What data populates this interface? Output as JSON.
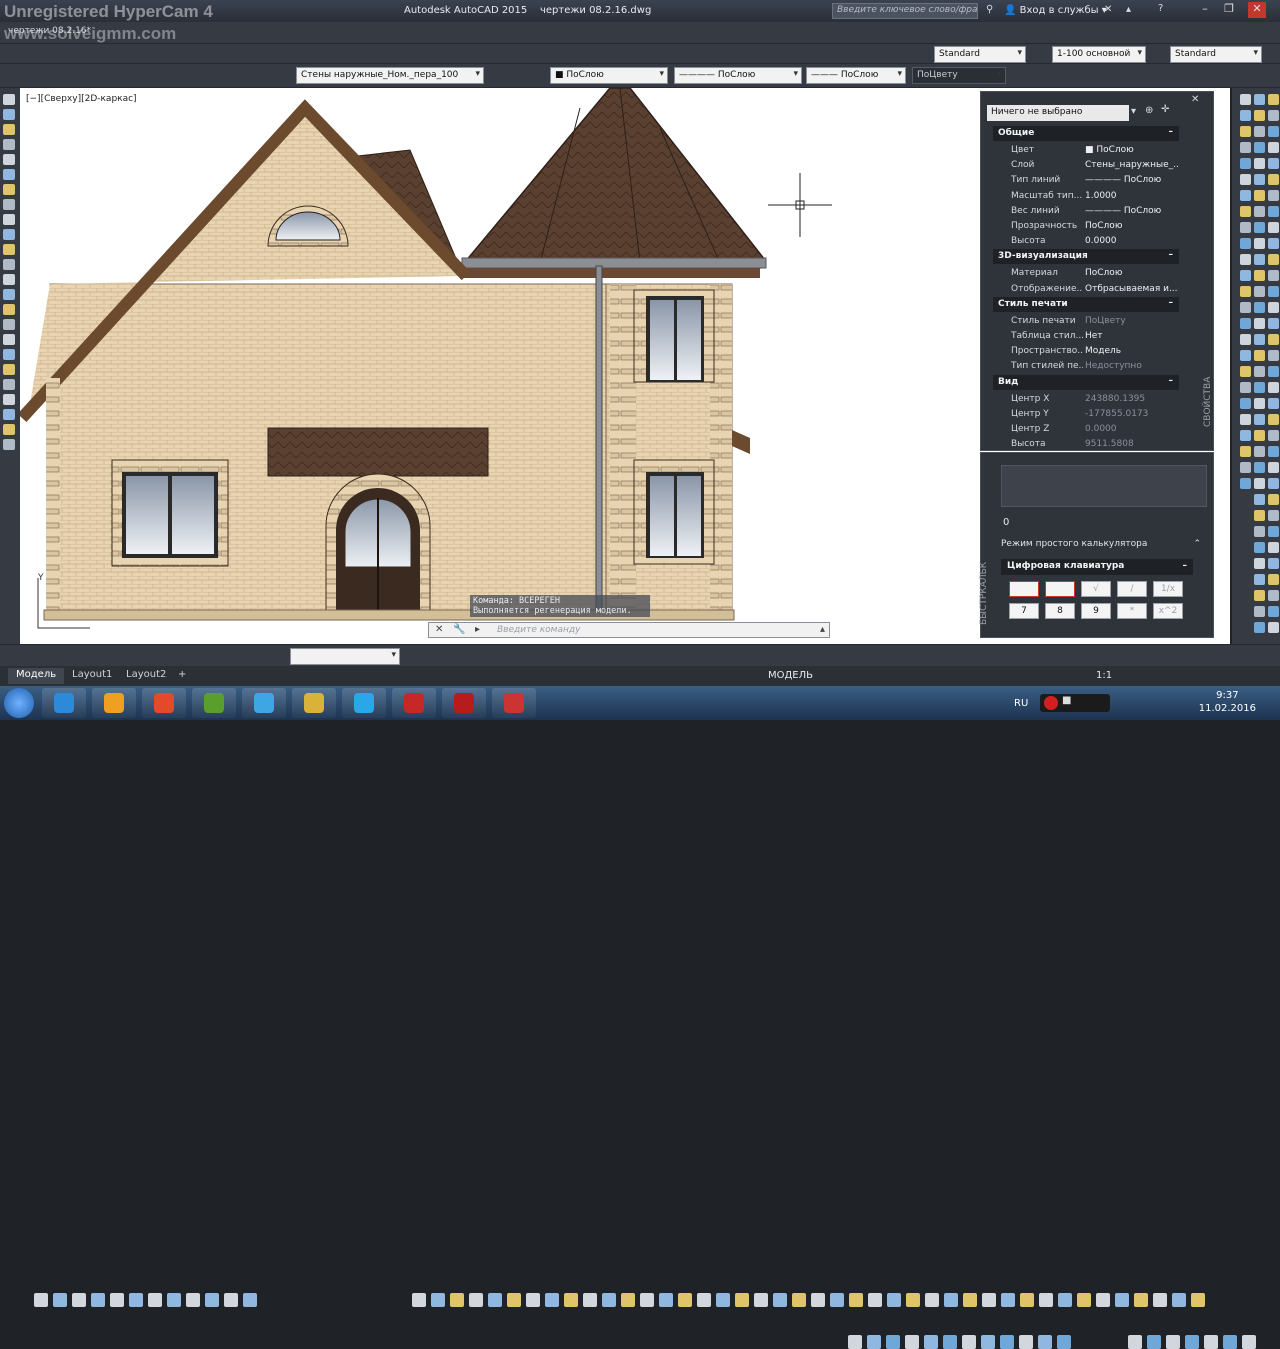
{
  "window": {
    "app_title": "Autodesk AutoCAD 2015",
    "file_title": "чертежи 08.2.16.dwg",
    "search_placeholder": "Введите ключевое слово/фразу",
    "signin": "Вход в службы",
    "watermark_top": "Unregistered HyperCam 4",
    "watermark_sub": "www.solveigmm.com",
    "tab_caption": "чертежи 08.2.16*"
  },
  "toolbar1": {
    "text_style": "Standard",
    "dim_scale": "1-100 основной",
    "table_style": "Standard"
  },
  "toolbar2": {
    "layer": "Стены наружные_Ном._пера_100",
    "color": "ПоСлою",
    "linetype": "ПоСлою",
    "lineweight": "ПоСлою",
    "plotstyle": "ПоЦвету"
  },
  "viewport": {
    "label": "[−][Сверху][2D-каркас]"
  },
  "properties": {
    "selection": "Ничего не выбрано",
    "palette_title": "СВОЙСТВА",
    "sections": [
      {
        "title": "Общие",
        "rows": [
          {
            "k": "Цвет",
            "v": "■ ПоСлою"
          },
          {
            "k": "Слой",
            "v": "Стены_наружные_..."
          },
          {
            "k": "Тип линий",
            "v": "———— ПоСлою"
          },
          {
            "k": "Масштаб тип...",
            "v": "1.0000"
          },
          {
            "k": "Вес линий",
            "v": "———— ПоСлою"
          },
          {
            "k": "Прозрачность",
            "v": "ПоСлою"
          },
          {
            "k": "Высота",
            "v": "0.0000"
          }
        ]
      },
      {
        "title": "3D-визуализация",
        "rows": [
          {
            "k": "Материал",
            "v": "ПоСлою"
          },
          {
            "k": "Отображение...",
            "v": "Отбрасываемая и..."
          }
        ]
      },
      {
        "title": "Стиль печати",
        "rows": [
          {
            "k": "Стиль печати",
            "v": "ПоЦвету"
          },
          {
            "k": "Таблица стил...",
            "v": "Нет"
          },
          {
            "k": "Пространство...",
            "v": "Модель"
          },
          {
            "k": "Тип стилей пе...",
            "v": "Недоступно"
          }
        ]
      },
      {
        "title": "Вид",
        "rows": [
          {
            "k": "Центр X",
            "v": "243880.1395"
          },
          {
            "k": "Центр Y",
            "v": "-177855.0173"
          },
          {
            "k": "Центр Z",
            "v": "0.0000"
          },
          {
            "k": "Высота",
            "v": "9511.5808"
          }
        ]
      }
    ]
  },
  "calculator": {
    "palette_title": "БЫСТРКАЛЬК",
    "value": "0",
    "mode": "Режим простого калькулятора",
    "keypad_title": "Цифровая клавиатура",
    "keys_row1": [
      "",
      "",
      "√",
      "/",
      "1/x"
    ],
    "keys_row2": [
      "7",
      "8",
      "9",
      "*",
      "x^2"
    ]
  },
  "command": {
    "history1": "Команда: ВСЕРЕГЕН",
    "history2": "Выполняется регенерация модели.",
    "placeholder": "Введите команду"
  },
  "layout_tabs": [
    "Модель",
    "Layout1",
    "Layout2",
    "+"
  ],
  "status": {
    "model": "МОДЕЛЬ",
    "scale": "1:1"
  },
  "taskbar": {
    "lang": "RU",
    "time": "9:37",
    "date": "11.02.2016"
  }
}
